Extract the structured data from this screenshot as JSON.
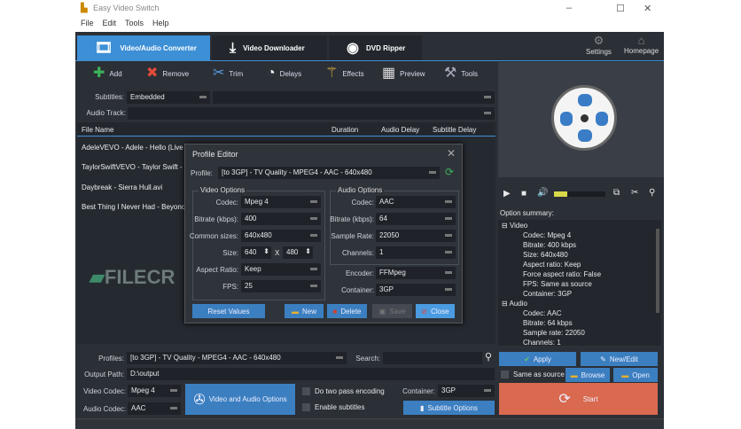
{
  "window": {
    "title": "Easy Video Switch",
    "menu": [
      "File",
      "Edit",
      "Tools",
      "Help"
    ]
  },
  "tabs": [
    {
      "label": "Video/Audio Converter",
      "icon": "film-icon"
    },
    {
      "label": "Video Downloader",
      "icon": "download-icon"
    },
    {
      "label": "DVD Ripper",
      "icon": "disc-icon"
    }
  ],
  "top_right": {
    "settings": "Settings",
    "homepage": "Homepage"
  },
  "toolbar": [
    {
      "label": "Add",
      "icon": "plus-icon"
    },
    {
      "label": "Remove",
      "icon": "x-icon"
    },
    {
      "label": "Trim",
      "icon": "scissors-icon"
    },
    {
      "label": "Delays",
      "icon": "clock-icon"
    },
    {
      "label": "Effects",
      "icon": "wand-icon"
    },
    {
      "label": "Preview",
      "icon": "preview-icon"
    },
    {
      "label": "Tools",
      "icon": "tools-icon"
    }
  ],
  "subtitles": {
    "label": "Subtitles:",
    "value": "Embedded"
  },
  "audio_track": {
    "label": "Audio Track:"
  },
  "columns": [
    "File Name",
    "Duration",
    "Audio Delay",
    "Subtitle Delay"
  ],
  "files": [
    "AdeleVEVO - Adele - Hello (Live at",
    "TaylorSwiftVEVO - Taylor Swift - W",
    "Daybreak - Sierra Hull.avi",
    "Best Thing I Never Had - Beyonce."
  ],
  "watermark": "FILECR .com",
  "dialog": {
    "title": "Profile Editor",
    "profile_label": "Profile:",
    "profile": "[to 3GP] - TV Quality - MPEG4 - AAC - 640x480",
    "video_title": "Video Options",
    "video": [
      {
        "label": "Codec:",
        "value": "Mpeg 4"
      },
      {
        "label": "Bitrate (kbps):",
        "value": "400"
      },
      {
        "label": "Common sizes:",
        "value": "640x480"
      }
    ],
    "size_label": "Size:",
    "width": "640",
    "x": "X",
    "height": "480",
    "video2": [
      {
        "label": "Aspect Ratio:",
        "value": "Keep"
      },
      {
        "label": "FPS:",
        "value": "25"
      }
    ],
    "audio_title": "Audio Options",
    "audio": [
      {
        "label": "Codec:",
        "value": "AAC"
      },
      {
        "label": "Bitrate (kbps):",
        "value": "64"
      },
      {
        "label": "Sample Rate:",
        "value": "22050"
      },
      {
        "label": "Channels:",
        "value": "1"
      }
    ],
    "encoder": {
      "label": "Encoder:",
      "value": "FFMpeg"
    },
    "container": {
      "label": "Container:",
      "value": "3GP"
    },
    "buttons": {
      "reset": "Reset Values",
      "new": "New",
      "delete": "Delete",
      "save": "Save",
      "close": "Close"
    }
  },
  "player": {
    "volume": 0.25
  },
  "summary": {
    "label": "Option summary:",
    "video": "Video",
    "video_items": [
      "Codec: Mpeg 4",
      "Bitrate: 400 kbps",
      "Size: 640x480",
      "Aspect ratio: Keep",
      "Force aspect ratio: False",
      "FPS: Same as source",
      "Container: 3GP"
    ],
    "audio": "Audio",
    "audio_items": [
      "Codec: AAC",
      "Bitrate: 64 kbps",
      "Sample rate: 22050",
      "Channels: 1"
    ]
  },
  "bottom": {
    "profiles_label": "Profiles:",
    "profiles": "[to 3GP] - TV Quality - MPEG4 - AAC - 640x480",
    "search_label": "Search:",
    "search": "",
    "output_label": "Output Path:",
    "output": "D:\\output",
    "vcodec_label": "Video Codec:",
    "vcodec": "Mpeg 4",
    "acodec_label": "Audio Codec:",
    "acodec": "AAC",
    "va_options": "Video and Audio Options",
    "two_pass": "Do two pass encoding",
    "enable_subs": "Enable subtitles",
    "container_label": "Container:",
    "container": "3GP",
    "subtitle_options": "Subtitle Options",
    "apply": "Apply",
    "new_edit": "New/Edit",
    "same_as_source": "Same as source",
    "browse": "Browse",
    "open": "Open",
    "start": "Start"
  }
}
